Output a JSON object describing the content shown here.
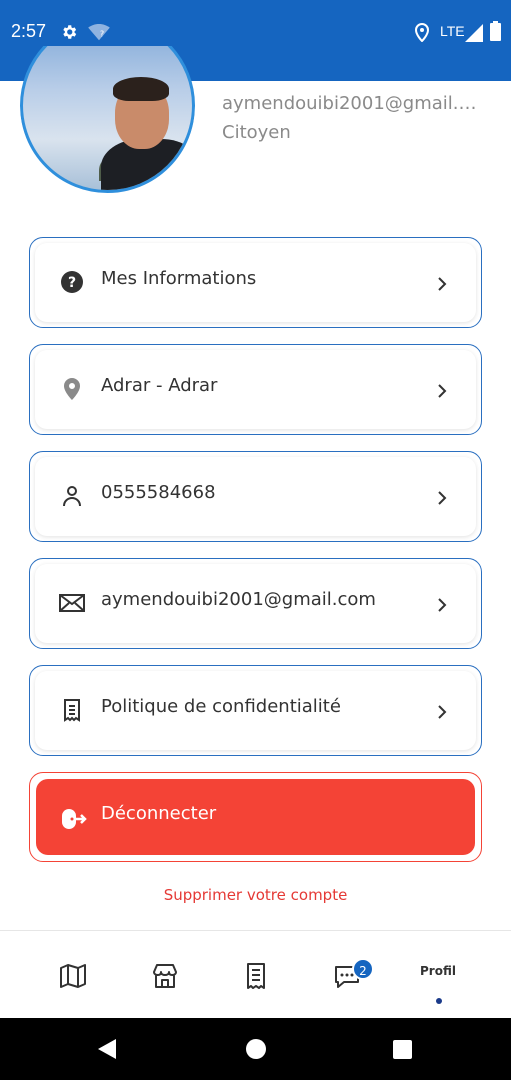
{
  "status_bar": {
    "time": "2:57",
    "network": "LTE",
    "icons": [
      "gear-icon",
      "wifi-unknown-icon",
      "location-icon",
      "signal-icon",
      "battery-icon"
    ]
  },
  "profile": {
    "email_display": "aymendouibi2001@gmail.c...",
    "role": "Citoyen"
  },
  "menu": {
    "items": [
      {
        "label": "Mes Informations",
        "icon": "help-circle-icon"
      },
      {
        "label": "Adrar - Adrar",
        "icon": "location-pin-icon"
      },
      {
        "label": "0555584668",
        "icon": "person-icon"
      },
      {
        "label": "aymendouibi2001@gmail.com",
        "icon": "envelope-icon"
      },
      {
        "label": "Politique de confidentialité",
        "icon": "receipt-icon"
      }
    ],
    "logout_label": "Déconnecter",
    "delete_label": "Supprimer votre compte"
  },
  "bottom_nav": {
    "items": [
      "map-icon",
      "store-icon",
      "receipt-icon",
      "chat-icon"
    ],
    "badge_count": "2",
    "active_label": "Profil"
  },
  "colors": {
    "primary": "#1565c0",
    "danger": "#f44336",
    "card_border": "#2a6fc0"
  }
}
